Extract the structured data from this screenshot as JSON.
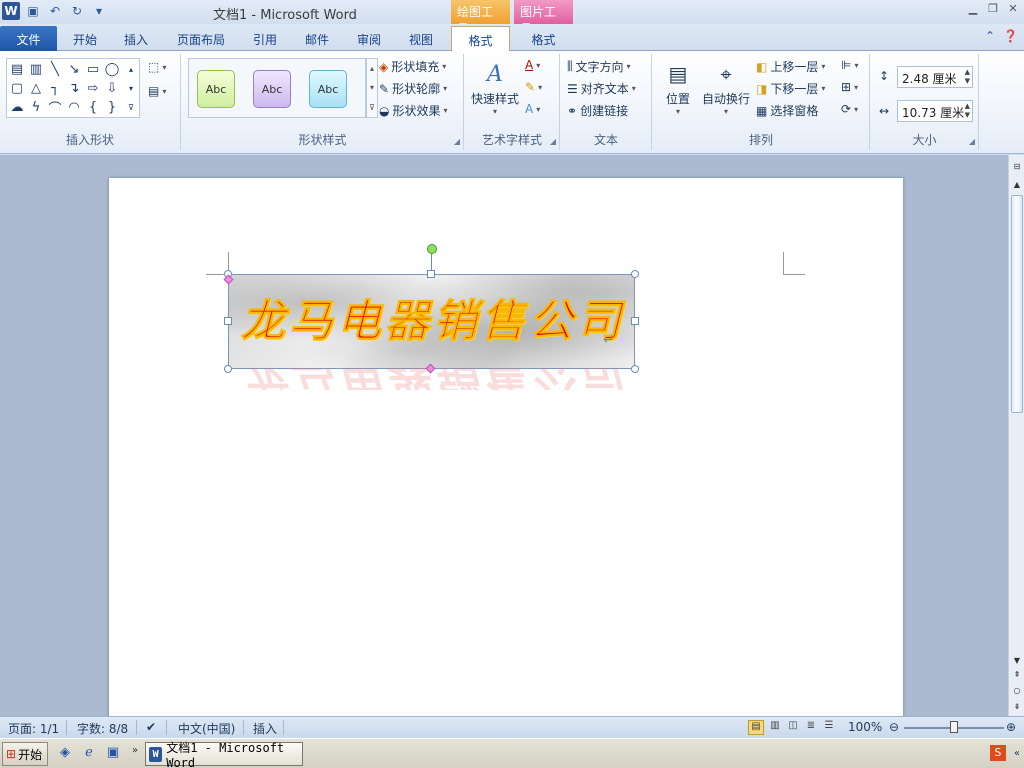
{
  "window": {
    "title": "文档1  -  Microsoft Word",
    "context_tabs": {
      "drawing_tools": "绘图工具",
      "picture_tools": "图片工具"
    }
  },
  "tabs": {
    "file": "文件",
    "items": [
      "开始",
      "插入",
      "页面布局",
      "引用",
      "邮件",
      "审阅",
      "视图",
      "格式",
      "格式"
    ]
  },
  "ribbon": {
    "insert_shapes": {
      "label": "插入形状"
    },
    "shape_styles": {
      "label": "形状样式",
      "preset_text": "Abc",
      "fill": "形状填充",
      "outline": "形状轮廓",
      "effects": "形状效果"
    },
    "wordart_styles": {
      "label": "艺术字样式",
      "quick_styles": "快速样式"
    },
    "text": {
      "label": "文本",
      "direction": "文字方向",
      "align": "对齐文本",
      "link": "创建链接"
    },
    "arrange": {
      "label": "排列",
      "position": "位置",
      "wrap": "自动换行",
      "bring_forward": "上移一层",
      "send_backward": "下移一层",
      "selection_pane": "选择窗格"
    },
    "size": {
      "label": "大小",
      "height": "2.48 厘米",
      "width": "10.73 厘米"
    }
  },
  "document": {
    "wordart_text": "龙马电器销售公司",
    "paragraph_mark": "↵"
  },
  "statusbar": {
    "page": "页面: 1/1",
    "words": "字数: 8/8",
    "language": "中文(中国)",
    "insert_mode": "插入",
    "zoom": "100%"
  },
  "taskbar": {
    "start": "开始",
    "word_task": "文档1 - Microsoft Word"
  },
  "colors": {
    "file_tab": "#1e55a8",
    "wordart_fill": "#e40000",
    "wordart_outline": "#f7b800",
    "drawing_tools_tab": "#f0a030",
    "picture_tools_tab": "#e060a0"
  }
}
